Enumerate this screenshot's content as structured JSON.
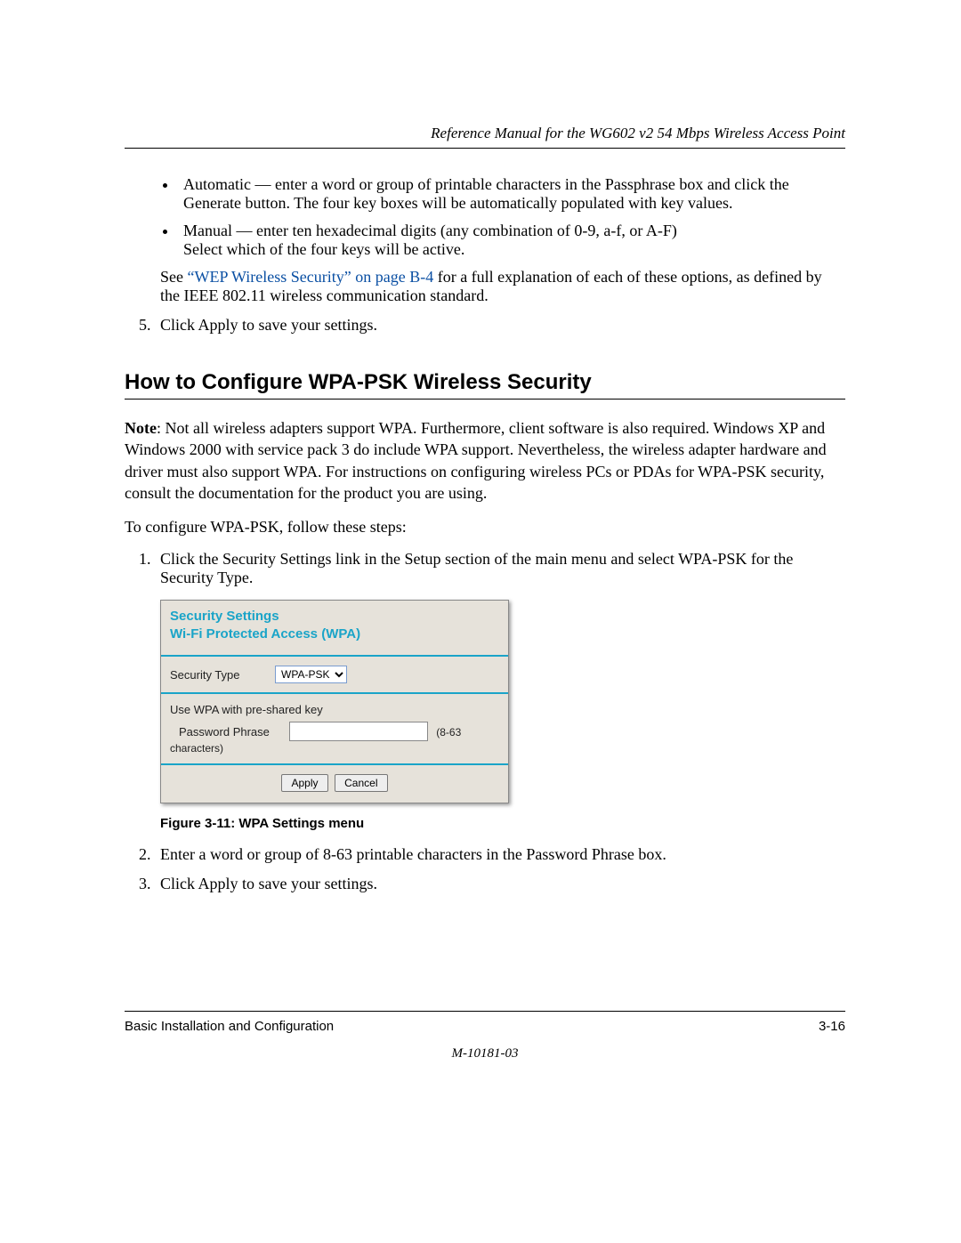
{
  "header": {
    "running_title": "Reference Manual for the WG602 v2 54 Mbps Wireless Access Point"
  },
  "top_list": {
    "bullet_auto": "Automatic — enter a word or group of printable characters in the Passphrase box and click the Generate button. The four key boxes will be automatically populated with key values.",
    "bullet_manual_line1": "Manual — enter ten hexadecimal digits (any combination of 0-9, a-f, or A-F)",
    "bullet_manual_line2": "Select which of the four keys will be active.",
    "see_prefix": "See ",
    "see_link": "“WEP Wireless Security” on page B-4",
    "see_suffix": " for a full explanation of each of these options, as defined by the IEEE 802.11 wireless communication standard.",
    "step5": "Click Apply to save your settings."
  },
  "section": {
    "heading": "How to Configure WPA-PSK Wireless Security",
    "note_para": "Note: Not all wireless adapters support WPA. Furthermore, client software is also required. Windows XP and Windows 2000 with service pack 3 do include WPA support. Nevertheless, the wireless adapter hardware and driver must also support WPA. For instructions on configuring wireless PCs or PDAs for WPA-PSK security, consult the documentation for the product you are using.",
    "note_label": "Note",
    "lead": "To configure WPA-PSK, follow these steps:",
    "step1": "Click the Security Settings link in the Setup section of the main menu and select WPA-PSK for the Security Type.",
    "step2": "Enter a word or group of 8-63 printable characters in the Password Phrase box.",
    "step3": "Click Apply to save your settings."
  },
  "figure": {
    "title_line1": "Security Settings",
    "title_line2": "Wi-Fi Protected Access (WPA)",
    "label_security_type": "Security Type",
    "select_value": "WPA-PSK",
    "label_use_wpa": "Use WPA with pre-shared key",
    "label_password": "Password Phrase",
    "hint": "(8-63 characters)",
    "btn_apply": "Apply",
    "btn_cancel": "Cancel",
    "caption": "Figure 3-11: WPA Settings menu"
  },
  "footer": {
    "left": "Basic Installation and Configuration",
    "right": "3-16",
    "docid": "M-10181-03"
  }
}
